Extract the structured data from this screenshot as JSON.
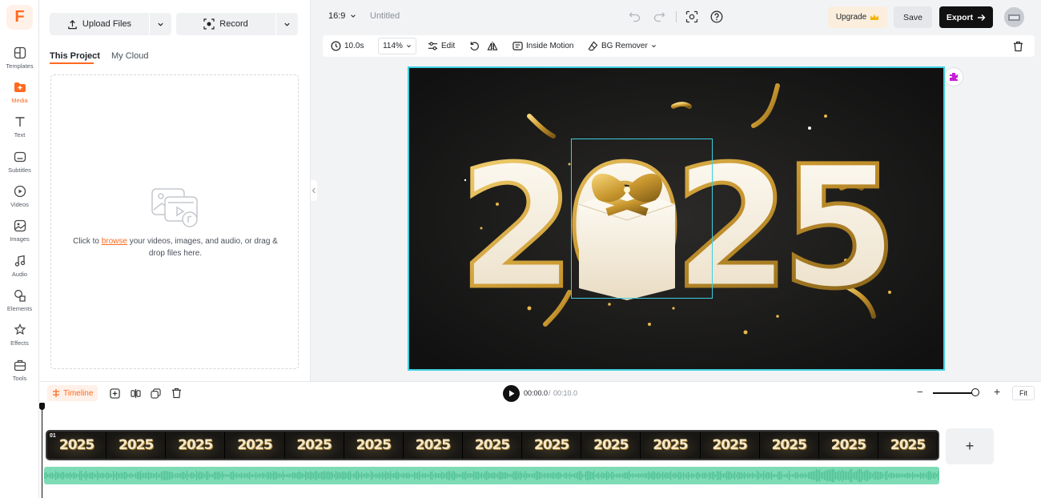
{
  "brand": {
    "logo_letter": "F",
    "accent": "#ff6a1f"
  },
  "rail": {
    "items": [
      {
        "label": "Templates",
        "icon": "templates-icon"
      },
      {
        "label": "Media",
        "icon": "media-icon",
        "active": true
      },
      {
        "label": "Text",
        "icon": "text-icon"
      },
      {
        "label": "Subtitles",
        "icon": "subtitles-icon"
      },
      {
        "label": "Videos",
        "icon": "videos-icon"
      },
      {
        "label": "Images",
        "icon": "images-icon"
      },
      {
        "label": "Audio",
        "icon": "audio-icon"
      },
      {
        "label": "Elements",
        "icon": "elements-icon"
      },
      {
        "label": "Effects",
        "icon": "effects-icon"
      },
      {
        "label": "Tools",
        "icon": "tools-icon"
      }
    ]
  },
  "media_panel": {
    "upload_label": "Upload Files",
    "record_label": "Record",
    "tabs": [
      {
        "label": "This Project",
        "active": true
      },
      {
        "label": "My Cloud"
      }
    ],
    "dropzone": {
      "text_before": "Click to ",
      "link": "browse",
      "text_after": " your videos, images, and audio, or drag & drop files here."
    }
  },
  "topbar": {
    "aspect_ratio": "16:9",
    "title": "Untitled",
    "upgrade_label": "Upgrade",
    "save_label": "Save",
    "export_label": "Export"
  },
  "toolbar": {
    "duration": "10.0s",
    "zoom": "114%",
    "edit_label": "Edit",
    "motion_label": "Inside Motion",
    "bg_remover_label": "BG Remover"
  },
  "canvas": {
    "content_text": "2025",
    "selection_color": "#3cd0e0"
  },
  "timeline": {
    "label": "Timeline",
    "current_time": "00:00.0",
    "separator": "/",
    "total_time": "00:10.0",
    "fit_label": "Fit",
    "zoom_level": 0.86,
    "clip": {
      "index": "01",
      "thumb_text": "2025",
      "frames": 15
    },
    "add_clip_label": "+"
  }
}
